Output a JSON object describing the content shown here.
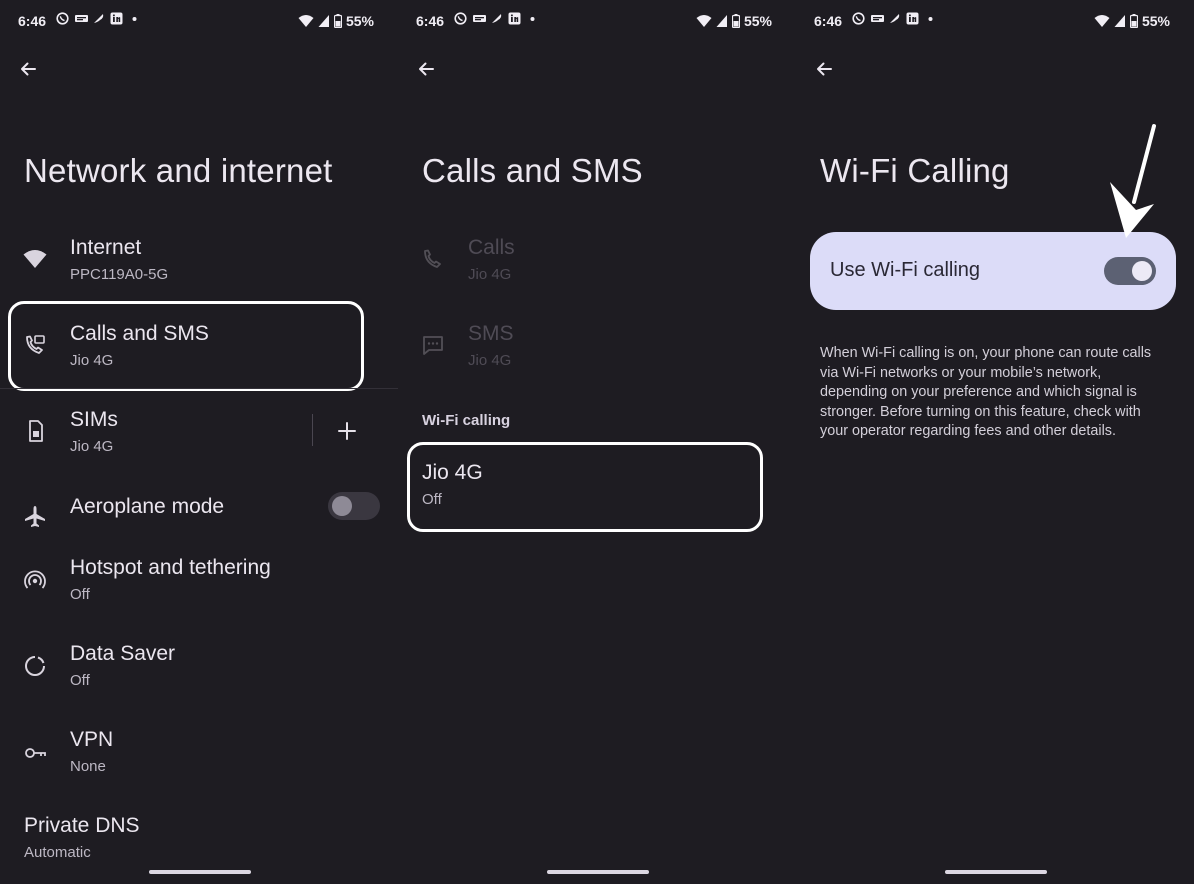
{
  "status_bar": {
    "time": "6:46",
    "battery": "55%"
  },
  "panel1": {
    "title": "Network and internet",
    "items": [
      {
        "title": "Internet",
        "subtitle": "PPC119A0-5G",
        "icon": "wifi-icon"
      },
      {
        "title": "Calls and SMS",
        "subtitle": "Jio 4G",
        "icon": "calls-sms-icon"
      },
      {
        "title": "SIMs",
        "subtitle": "Jio 4G",
        "icon": "sim-card-icon"
      },
      {
        "title": "Aeroplane mode",
        "subtitle": "",
        "icon": "airplane-icon"
      },
      {
        "title": "Hotspot and tethering",
        "subtitle": "Off",
        "icon": "hotspot-icon"
      },
      {
        "title": "Data Saver",
        "subtitle": "Off",
        "icon": "data-saver-icon"
      },
      {
        "title": "VPN",
        "subtitle": "None",
        "icon": "vpn-key-icon"
      },
      {
        "title": "Private DNS",
        "subtitle": "Automatic",
        "icon": ""
      }
    ],
    "sims_add_label": "+",
    "aeroplane_mode_on": false
  },
  "panel2": {
    "title": "Calls and SMS",
    "items": [
      {
        "title": "Calls",
        "subtitle": "Jio 4G",
        "icon": "phone-icon"
      },
      {
        "title": "SMS",
        "subtitle": "Jio 4G",
        "icon": "message-icon"
      }
    ],
    "section_label": "Wi-Fi calling",
    "wifi_calling_item": {
      "title": "Jio 4G",
      "subtitle": "Off"
    }
  },
  "panel3": {
    "title": "Wi-Fi Calling",
    "toggle_label": "Use Wi-Fi calling",
    "toggle_on": true,
    "description": "When Wi-Fi calling is on, your phone can route calls via Wi-Fi networks or your mobile’s network, depending on your preference and which signal is stronger. Before turning on this feature, check with your operator regarding fees and other details."
  },
  "colors": {
    "background": "#1e1c22",
    "highlight_border": "#ffffff",
    "card_bg": "#dcdcf8",
    "toggle_on_track": "#5c6173",
    "toggle_off_track": "#3a3740"
  }
}
